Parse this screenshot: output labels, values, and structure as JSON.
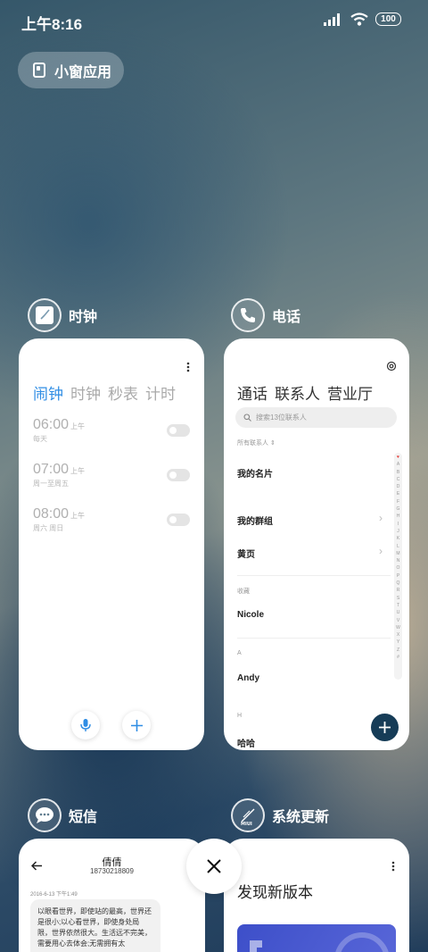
{
  "status": {
    "time": "上午8:16",
    "battery": "100"
  },
  "float_button": {
    "label": "小窗应用"
  },
  "apps": {
    "clock": {
      "title": "时钟",
      "tabs": [
        "闹钟",
        "时钟",
        "秒表",
        "计时"
      ],
      "alarms": [
        {
          "time": "06:00",
          "ampm": "上午",
          "repeat": "每天"
        },
        {
          "time": "07:00",
          "ampm": "上午",
          "repeat": "周一至周五"
        },
        {
          "time": "08:00",
          "ampm": "上午",
          "repeat": "周六 周日"
        }
      ]
    },
    "phone": {
      "title": "电话",
      "tabs": [
        "通话",
        "联系人",
        "营业厅"
      ],
      "search_placeholder": "搜索13位联系人",
      "filter": "所有联系人",
      "my_card": "我的名片",
      "my_groups": "我的群组",
      "yellow_pages": "黄页",
      "favorites_label": "收藏",
      "favorite_contact": "Nicole",
      "section_a": "A",
      "contact_a": "Andy",
      "section_h": "H",
      "contact_h": "哈哈",
      "alphabet": [
        "♥",
        "A",
        "B",
        "C",
        "D",
        "E",
        "F",
        "G",
        "H",
        "I",
        "J",
        "K",
        "L",
        "M",
        "N",
        "O",
        "P",
        "Q",
        "R",
        "S",
        "T",
        "U",
        "V",
        "W",
        "X",
        "Y",
        "Z",
        "#"
      ]
    },
    "sms": {
      "title": "短信",
      "contact_name": "倩倩",
      "contact_number": "18730218809",
      "date": "2016-6-13 下午1:49",
      "message": "以眼看世界，即使站的最高，世界还是很小;以心看世界，即使身处局限，世界依然很大。生活远不完美，需要用心去体会;无需拥有太"
    },
    "update": {
      "title": "系统更新",
      "heading": "发现新版本"
    }
  },
  "colors": {
    "accent_blue": "#2f8de4",
    "fab_dark": "#163c57"
  }
}
